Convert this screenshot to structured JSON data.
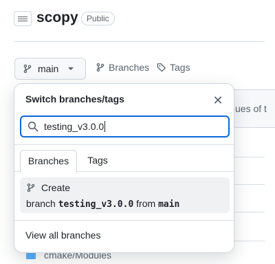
{
  "repo": {
    "name": "scopy",
    "visibility": "Public"
  },
  "branch_selector": {
    "current": "main"
  },
  "nav": {
    "branches": "Branches",
    "tags": "Tags"
  },
  "background": {
    "commit_text_fragment": "ues of t",
    "file_name": "cmake/Modules"
  },
  "popover": {
    "title": "Switch branches/tags",
    "search_value": "testing_v3.0.0",
    "tabs": [
      {
        "label": "Branches",
        "active": true
      },
      {
        "label": "Tags",
        "active": false
      }
    ],
    "create": {
      "label": "Create",
      "prefix": "branch",
      "branch_name": "testing_v3.0.0",
      "from_word": "from",
      "source": "main"
    },
    "view_all": "View all branches"
  },
  "colors": {
    "accent": "#0969da",
    "text": "#1f2328",
    "muted": "#59636e",
    "border": "#d0d7de"
  }
}
